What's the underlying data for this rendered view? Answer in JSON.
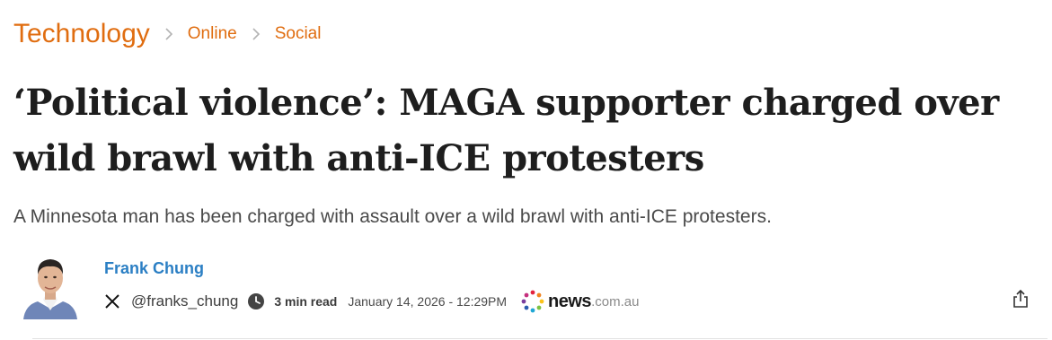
{
  "breadcrumb": {
    "section": "Technology",
    "subsection": "Online",
    "topic": "Social"
  },
  "headline": "‘Political violence’: MAGA supporter charged over wild brawl with anti-ICE protesters",
  "dek": "A Minnesota man has been charged with assault over a wild brawl with anti-ICE protesters.",
  "byline": {
    "author_name": "Frank Chung",
    "social_icon": "x-logo-icon",
    "handle": "@franks_chung",
    "read_time_icon": "clock-icon",
    "read_time": "3 min read",
    "date": "January 14, 2026 - 12:29PM"
  },
  "publisher": {
    "name": "news",
    "suffix": ".com.au"
  },
  "actions": {
    "share_icon": "share-icon"
  },
  "colors": {
    "accent": "#e06d10",
    "author_link": "#2b7fc4",
    "headline": "#1e1e1e"
  }
}
